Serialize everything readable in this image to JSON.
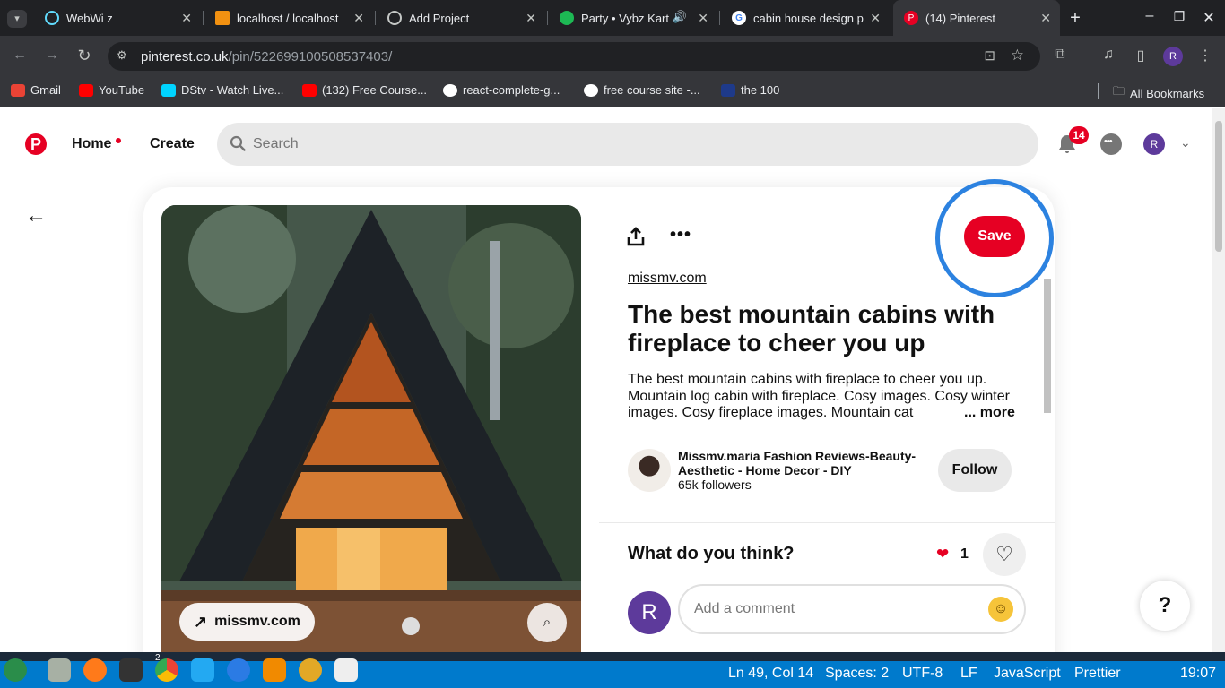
{
  "browser": {
    "tabs": [
      {
        "title": "WebWi z",
        "color": "#61dafb"
      },
      {
        "title": "localhost / localhost",
        "color": "#f29111"
      },
      {
        "title": "Add Project",
        "color": "#9aa0a6"
      },
      {
        "title": "Party • Vybz Kart",
        "color": "#1db954"
      },
      {
        "title": "cabin house design p",
        "color": "#ffffff"
      },
      {
        "title": "(14) Pinterest",
        "color": "#e60023"
      }
    ],
    "url_host": "pinterest.co.uk",
    "url_path": "/pin/522699100508537403/",
    "bookmarks": [
      {
        "label": "Gmail",
        "color": "#ea4335"
      },
      {
        "label": "YouTube",
        "color": "#ff0000"
      },
      {
        "label": "DStv - Watch Live...",
        "color": "#00d4ff"
      },
      {
        "label": "(132) Free Course...",
        "color": "#ff0000"
      },
      {
        "label": "react-complete-g...",
        "color": "#ffffff"
      },
      {
        "label": "free course site -...",
        "color": "#ffffff"
      },
      {
        "label": "the 100",
        "color": "#1e3a8a"
      }
    ],
    "all_bookmarks": "All Bookmarks",
    "profile_initial": "R"
  },
  "header": {
    "logo": "P",
    "home": "Home",
    "create": "Create",
    "search_placeholder": "Search",
    "notifications": "14",
    "avatar": "R"
  },
  "pin": {
    "source_button": "missmv.com",
    "save": "Save",
    "site": "missmv.com",
    "title": "The best mountain cabins with fireplace to cheer you up",
    "description": "The best mountain cabins with fireplace to cheer you up. Mountain log cabin with fireplace. Cosy images. Cosy winter images. Cosy fireplace images. Mountain cat",
    "more": "... more",
    "author": "Missmv.maria Fashion Reviews-Beauty-Aesthetic - Home Decor - DIY",
    "followers": "65k followers",
    "follow": "Follow",
    "comments_heading": "What do you think?",
    "reactions": "1",
    "comment_avatar": "R",
    "comment_placeholder": "Add a comment",
    "help": "?"
  },
  "statusbar": {
    "position": "Ln 49, Col 14",
    "spaces": "Spaces: 2",
    "encoding": "UTF-8",
    "eol": "LF",
    "language": "JavaScript",
    "prettier": "Prettier",
    "clock": "19:07",
    "badge": "2"
  }
}
